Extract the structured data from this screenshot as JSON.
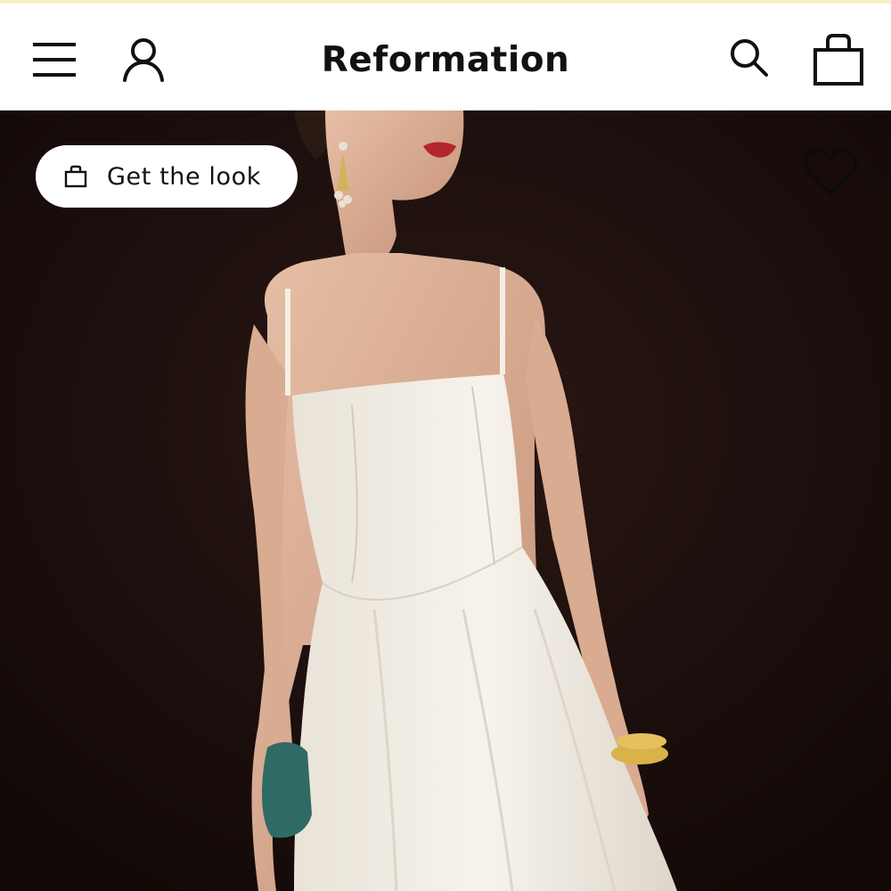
{
  "header": {
    "brand": "Reformation",
    "icons": {
      "menu": "menu-icon",
      "account": "account-icon",
      "search": "search-icon",
      "bag": "shopping-bag-icon"
    }
  },
  "hero": {
    "get_the_look_label": "Get the look",
    "get_the_look_icon": "shopping-bag-icon",
    "wishlist_icon": "heart-icon",
    "image_description_icon": "product-photo",
    "background_color": "#170c0a"
  },
  "colors": {
    "top_strip": "#f5efc2",
    "text": "#111111"
  }
}
